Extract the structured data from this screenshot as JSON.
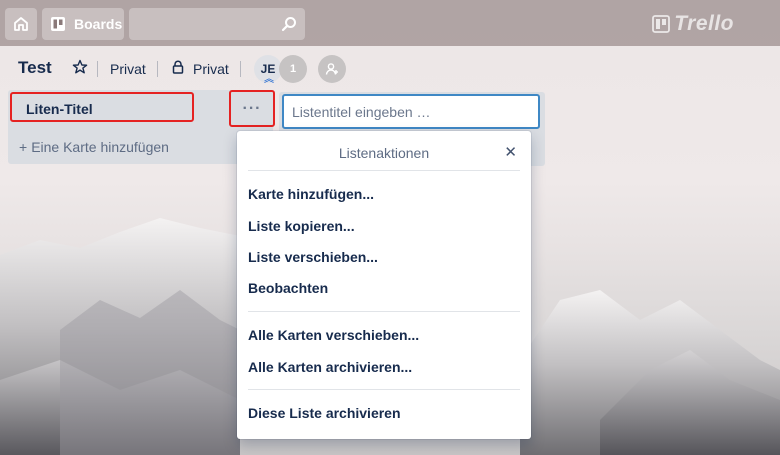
{
  "topbar": {
    "home_icon": "home-icon",
    "boards_label": "Boards",
    "search_placeholder": "",
    "logo_text": "Trello"
  },
  "board": {
    "title": "Test",
    "visibility_1": "Privat",
    "visibility_2": "Privat",
    "member_initials": "JE",
    "member_count": "1"
  },
  "list": {
    "title": "Liten-Titel",
    "menu_glyph": "···",
    "add_card_label": "Eine Karte hinzufügen"
  },
  "add_list": {
    "placeholder": "Listentitel eingeben …"
  },
  "popover": {
    "title": "Listenaktionen",
    "close_glyph": "✕",
    "group1": [
      "Karte hinzufügen...",
      "Liste kopieren...",
      "Liste verschieben...",
      "Beobachten"
    ],
    "group2": [
      "Alle Karten verschieben...",
      "Alle Karten archivieren..."
    ],
    "group3": [
      "Diese Liste archivieren"
    ]
  },
  "colors": {
    "highlight": "#e52222",
    "text_primary": "#172b4d",
    "input_focus": "#3f88c5"
  }
}
